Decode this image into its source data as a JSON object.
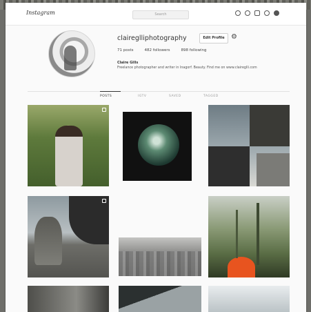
{
  "topbar": {
    "logo": "Instagram",
    "search_placeholder": "Search",
    "icons": [
      "compass-icon",
      "heart-icon",
      "messages-icon",
      "activity-icon",
      "profile-avatar-icon"
    ]
  },
  "profile": {
    "username": "claireglliphotography",
    "edit_profile_label": "Edit Profile",
    "settings_icon": "gear-icon",
    "stats": {
      "posts": "71 posts",
      "followers": "482 followers",
      "following": "898 following"
    },
    "full_name": "Claire Gills",
    "bio": "Freelance photographer and writer in Inagorf. Beauty. Find me on www.claireglli.com"
  },
  "tabs": [
    {
      "label": "POSTS",
      "active": true
    },
    {
      "label": "IGTV",
      "active": false
    },
    {
      "label": "SAVED",
      "active": false
    },
    {
      "label": "TAGGED",
      "active": false
    }
  ],
  "colors": {
    "background": "#fafafa",
    "text": "#262626",
    "accent": "#e8541f"
  }
}
